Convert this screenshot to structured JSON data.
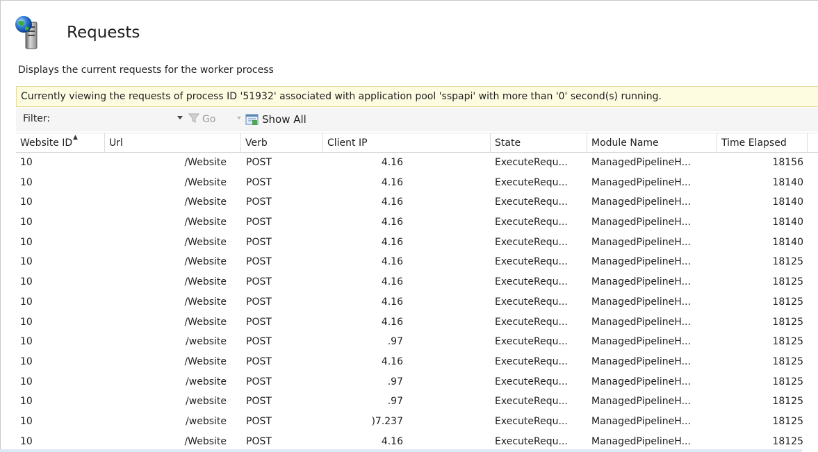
{
  "page": {
    "title": "Requests",
    "description": "Displays the current requests for the worker process",
    "info": "Currently viewing the requests of process ID '51932' associated with application pool 'sspapi' with more than '0' second(s) running.",
    "icon": "server-globe-icon"
  },
  "toolbar": {
    "filter_label": "Filter:",
    "filter_value": "",
    "go_label": "Go",
    "show_all_label": "Show All"
  },
  "table": {
    "columns": [
      "Website ID",
      "Url",
      "Verb",
      "Client IP",
      "State",
      "Module Name",
      "Time Elapsed"
    ],
    "sorted_column": "Website ID",
    "rows": [
      {
        "website_id": "10",
        "url": "/Website",
        "verb": "POST",
        "client_ip": "4.16",
        "state": "ExecuteRequ...",
        "module": "ManagedPipelineH...",
        "time": "18156"
      },
      {
        "website_id": "10",
        "url": "/Website",
        "verb": "POST",
        "client_ip": "4.16",
        "state": "ExecuteRequ...",
        "module": "ManagedPipelineH...",
        "time": "18140"
      },
      {
        "website_id": "10",
        "url": "/Website",
        "verb": "POST",
        "client_ip": "4.16",
        "state": "ExecuteRequ...",
        "module": "ManagedPipelineH...",
        "time": "18140"
      },
      {
        "website_id": "10",
        "url": "/Website",
        "verb": "POST",
        "client_ip": "4.16",
        "state": "ExecuteRequ...",
        "module": "ManagedPipelineH...",
        "time": "18140"
      },
      {
        "website_id": "10",
        "url": "/Website",
        "verb": "POST",
        "client_ip": "4.16",
        "state": "ExecuteRequ...",
        "module": "ManagedPipelineH...",
        "time": "18140"
      },
      {
        "website_id": "10",
        "url": "/Website",
        "verb": "POST",
        "client_ip": "4.16",
        "state": "ExecuteRequ...",
        "module": "ManagedPipelineH...",
        "time": "18125"
      },
      {
        "website_id": "10",
        "url": "/Website",
        "verb": "POST",
        "client_ip": "4.16",
        "state": "ExecuteRequ...",
        "module": "ManagedPipelineH...",
        "time": "18125"
      },
      {
        "website_id": "10",
        "url": "/Website",
        "verb": "POST",
        "client_ip": "4.16",
        "state": "ExecuteRequ...",
        "module": "ManagedPipelineH...",
        "time": "18125"
      },
      {
        "website_id": "10",
        "url": "/Website",
        "verb": "POST",
        "client_ip": "4.16",
        "state": "ExecuteRequ...",
        "module": "ManagedPipelineH...",
        "time": "18125"
      },
      {
        "website_id": "10",
        "url": "/website",
        "verb": "POST",
        "client_ip": ".97",
        "state": "ExecuteRequ...",
        "module": "ManagedPipelineH...",
        "time": "18125"
      },
      {
        "website_id": "10",
        "url": "/Website",
        "verb": "POST",
        "client_ip": "4.16",
        "state": "ExecuteRequ...",
        "module": "ManagedPipelineH...",
        "time": "18125"
      },
      {
        "website_id": "10",
        "url": "/website",
        "verb": "POST",
        "client_ip": ".97",
        "state": "ExecuteRequ...",
        "module": "ManagedPipelineH...",
        "time": "18125"
      },
      {
        "website_id": "10",
        "url": "/website",
        "verb": "POST",
        "client_ip": ".97",
        "state": "ExecuteRequ...",
        "module": "ManagedPipelineH...",
        "time": "18125"
      },
      {
        "website_id": "10",
        "url": "/website",
        "verb": "POST",
        "client_ip": ")7.237",
        "state": "ExecuteRequ...",
        "module": "ManagedPipelineH...",
        "time": "18125"
      },
      {
        "website_id": "10",
        "url": "/Website",
        "verb": "POST",
        "client_ip": "4.16",
        "state": "ExecuteRequ...",
        "module": "ManagedPipelineH...",
        "time": "18125"
      }
    ]
  }
}
